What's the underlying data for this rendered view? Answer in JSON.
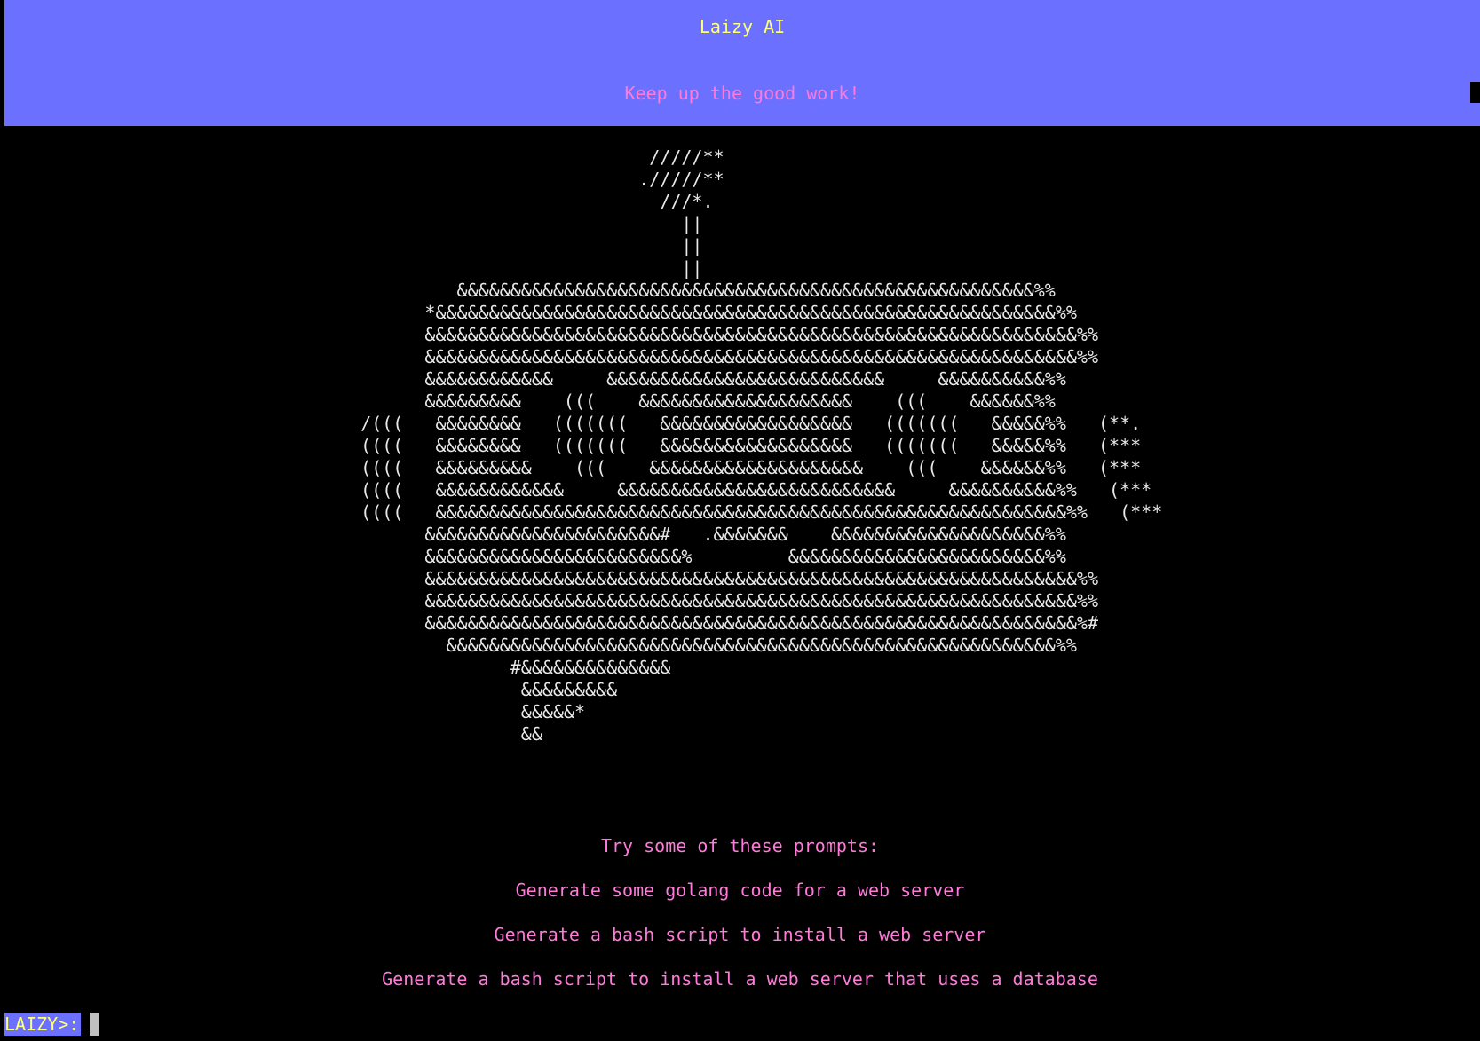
{
  "colors": {
    "background": "#000000",
    "header_bg": "#6b70ff",
    "title_color": "#ffff7a",
    "accent_pink": "#ff7ad9",
    "art_color": "#e8e8e8",
    "cursor_color": "#c0c0c0"
  },
  "header": {
    "title": "Laizy AI",
    "subtitle": "Keep up the good work!"
  },
  "ascii_art": {
    "lines": [
      "                                           /////**",
      "                                          ./////**",
      "                                            ///*.",
      "                                              ||",
      "                                              ||",
      "                                              ||",
      "                         &&&&&&&&&&&&&&&&&&&&&&&&&&&&&&&&&&&&&&&&&&&&&&&&&&&&&&%%",
      "                      *&&&&&&&&&&&&&&&&&&&&&&&&&&&&&&&&&&&&&&&&&&&&&&&&&&&&&&&&&&%%",
      "                      &&&&&&&&&&&&&&&&&&&&&&&&&&&&&&&&&&&&&&&&&&&&&&&&&&&&&&&&&&&&&%%",
      "                      &&&&&&&&&&&&&&&&&&&&&&&&&&&&&&&&&&&&&&&&&&&&&&&&&&&&&&&&&&&&&%%",
      "                      &&&&&&&&&&&&     &&&&&&&&&&&&&&&&&&&&&&&&&&     &&&&&&&&&&%%",
      "                      &&&&&&&&&    (((    &&&&&&&&&&&&&&&&&&&&    (((    &&&&&&%%",
      "                /(((   &&&&&&&&   (((((((   &&&&&&&&&&&&&&&&&&   (((((((   &&&&&%%   (**.",
      "                ((((   &&&&&&&&   (((((((   &&&&&&&&&&&&&&&&&&   (((((((   &&&&&%%   (***",
      "                ((((   &&&&&&&&&    (((    &&&&&&&&&&&&&&&&&&&&    (((    &&&&&&%%   (***",
      "                ((((   &&&&&&&&&&&&     &&&&&&&&&&&&&&&&&&&&&&&&&&     &&&&&&&&&&%%   (***",
      "                ((((   &&&&&&&&&&&&&&&&&&&&&&&&&&&&&&&&&&&&&&&&&&&&&&&&&&&&&&&&&&&%%   (***",
      "                      &&&&&&&&&&&&&&&&&&&&&&#   .&&&&&&&    &&&&&&&&&&&&&&&&&&&&%%",
      "                      &&&&&&&&&&&&&&&&&&&&&&&&%         &&&&&&&&&&&&&&&&&&&&&&&&%%",
      "                      &&&&&&&&&&&&&&&&&&&&&&&&&&&&&&&&&&&&&&&&&&&&&&&&&&&&&&&&&&&&&%%",
      "                      &&&&&&&&&&&&&&&&&&&&&&&&&&&&&&&&&&&&&&&&&&&&&&&&&&&&&&&&&&&&&%%",
      "                      &&&&&&&&&&&&&&&&&&&&&&&&&&&&&&&&&&&&&&&&&&&&&&&&&&&&&&&&&&&&&%#",
      "                        &&&&&&&&&&&&&&&&&&&&&&&&&&&&&&&&&&&&&&&&&&&&&&&&&&&&&&&&&%%",
      "                              #&&&&&&&&&&&&&&",
      "                               &&&&&&&&&",
      "                               &&&&&*",
      "                               &&"
    ]
  },
  "prompts": {
    "heading": "Try some of these prompts:",
    "items": [
      "Generate some golang code for a web server",
      "Generate a bash script to install a web server",
      "Generate a bash script to install a web server that uses a database"
    ]
  },
  "input": {
    "prompt_label": "LAIZY>:",
    "value": ""
  }
}
